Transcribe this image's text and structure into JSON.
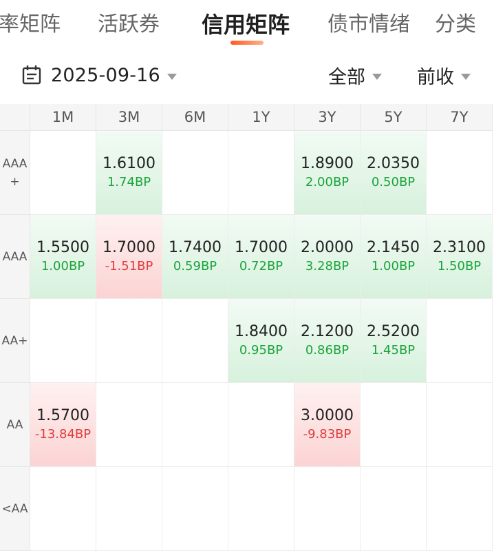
{
  "tabs": [
    {
      "label": "率矩阵",
      "active": false
    },
    {
      "label": "活跃券",
      "active": false
    },
    {
      "label": "信用矩阵",
      "active": true
    },
    {
      "label": "债市情绪",
      "active": false
    },
    {
      "label": "分类",
      "active": false
    }
  ],
  "filters": {
    "date": "2025-09-16",
    "scope": "全部",
    "compare": "前收"
  },
  "matrix": {
    "columns": [
      "1M",
      "3M",
      "6M",
      "1Y",
      "3Y",
      "5Y",
      "7Y"
    ],
    "rows": [
      {
        "label": "AAA\n+",
        "cells": [
          null,
          {
            "value": "1.6100",
            "change": "1.74BP",
            "trend": "up"
          },
          null,
          null,
          {
            "value": "1.8900",
            "change": "2.00BP",
            "trend": "up"
          },
          {
            "value": "2.0350",
            "change": "0.50BP",
            "trend": "up"
          },
          null
        ]
      },
      {
        "label": "AAA",
        "cells": [
          {
            "value": "1.5500",
            "change": "1.00BP",
            "trend": "up"
          },
          {
            "value": "1.7000",
            "change": "-1.51BP",
            "trend": "down"
          },
          {
            "value": "1.7400",
            "change": "0.59BP",
            "trend": "up"
          },
          {
            "value": "1.7000",
            "change": "0.72BP",
            "trend": "up"
          },
          {
            "value": "2.0000",
            "change": "3.28BP",
            "trend": "up"
          },
          {
            "value": "2.1450",
            "change": "1.00BP",
            "trend": "up"
          },
          {
            "value": "2.3100",
            "change": "1.50BP",
            "trend": "up"
          }
        ]
      },
      {
        "label": "AA+",
        "cells": [
          null,
          null,
          null,
          {
            "value": "1.8400",
            "change": "0.95BP",
            "trend": "up"
          },
          {
            "value": "2.1200",
            "change": "0.86BP",
            "trend": "up"
          },
          {
            "value": "2.5200",
            "change": "1.45BP",
            "trend": "up"
          },
          null
        ]
      },
      {
        "label": "AA",
        "cells": [
          {
            "value": "1.5700",
            "change": "-13.84BP",
            "trend": "down"
          },
          null,
          null,
          null,
          {
            "value": "3.0000",
            "change": "-9.83BP",
            "trend": "down"
          },
          null,
          null
        ]
      },
      {
        "label": "<AA",
        "cells": [
          null,
          null,
          null,
          null,
          null,
          null,
          null
        ]
      }
    ]
  },
  "icons": {
    "date": "calendar-icon",
    "dropdown": "caret-down-icon"
  },
  "colors": {
    "accent": "#ff5a1f",
    "up": "#1aa43a",
    "down": "#e23a3a",
    "up_bg": "#d7f1dd",
    "down_bg": "#fbd3d3"
  }
}
